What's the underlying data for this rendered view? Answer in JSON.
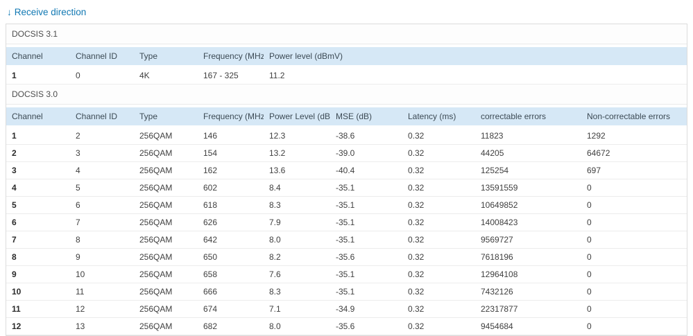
{
  "page": {
    "title": "Receive direction",
    "title_icon": "↓"
  },
  "colors": {
    "accent": "#1178b3",
    "table_header_bg": "#d6e8f6",
    "border": "#dcdcdc",
    "row_divider": "#ececec"
  },
  "sections": [
    {
      "name": "DOCSIS 3.1",
      "headers": [
        "Channel",
        "Channel ID",
        "Type",
        "Frequency (MHz)",
        "Power level (dBmV)"
      ],
      "rows": [
        [
          "1",
          "0",
          "4K",
          "167 - 325",
          "11.2"
        ]
      ]
    },
    {
      "name": "DOCSIS 3.0",
      "headers": [
        "Channel",
        "Channel ID",
        "Type",
        "Frequency (MHz)",
        "Power Level (dBmV)",
        "MSE (dB)",
        "Latency (ms)",
        "correctable errors",
        "Non-correctable errors"
      ],
      "rows": [
        [
          "1",
          "2",
          "256QAM",
          "146",
          "12.3",
          "-38.6",
          "0.32",
          "11823",
          "1292"
        ],
        [
          "2",
          "3",
          "256QAM",
          "154",
          "13.2",
          "-39.0",
          "0.32",
          "44205",
          "64672"
        ],
        [
          "3",
          "4",
          "256QAM",
          "162",
          "13.6",
          "-40.4",
          "0.32",
          "125254",
          "697"
        ],
        [
          "4",
          "5",
          "256QAM",
          "602",
          "8.4",
          "-35.1",
          "0.32",
          "13591559",
          "0"
        ],
        [
          "5",
          "6",
          "256QAM",
          "618",
          "8.3",
          "-35.1",
          "0.32",
          "10649852",
          "0"
        ],
        [
          "6",
          "7",
          "256QAM",
          "626",
          "7.9",
          "-35.1",
          "0.32",
          "14008423",
          "0"
        ],
        [
          "7",
          "8",
          "256QAM",
          "642",
          "8.0",
          "-35.1",
          "0.32",
          "9569727",
          "0"
        ],
        [
          "8",
          "9",
          "256QAM",
          "650",
          "8.2",
          "-35.6",
          "0.32",
          "7618196",
          "0"
        ],
        [
          "9",
          "10",
          "256QAM",
          "658",
          "7.6",
          "-35.1",
          "0.32",
          "12964108",
          "0"
        ],
        [
          "10",
          "11",
          "256QAM",
          "666",
          "8.3",
          "-35.1",
          "0.32",
          "7432126",
          "0"
        ],
        [
          "11",
          "12",
          "256QAM",
          "674",
          "7.1",
          "-34.9",
          "0.32",
          "22317877",
          "0"
        ],
        [
          "12",
          "13",
          "256QAM",
          "682",
          "8.0",
          "-35.6",
          "0.32",
          "9454684",
          "0"
        ]
      ]
    }
  ]
}
